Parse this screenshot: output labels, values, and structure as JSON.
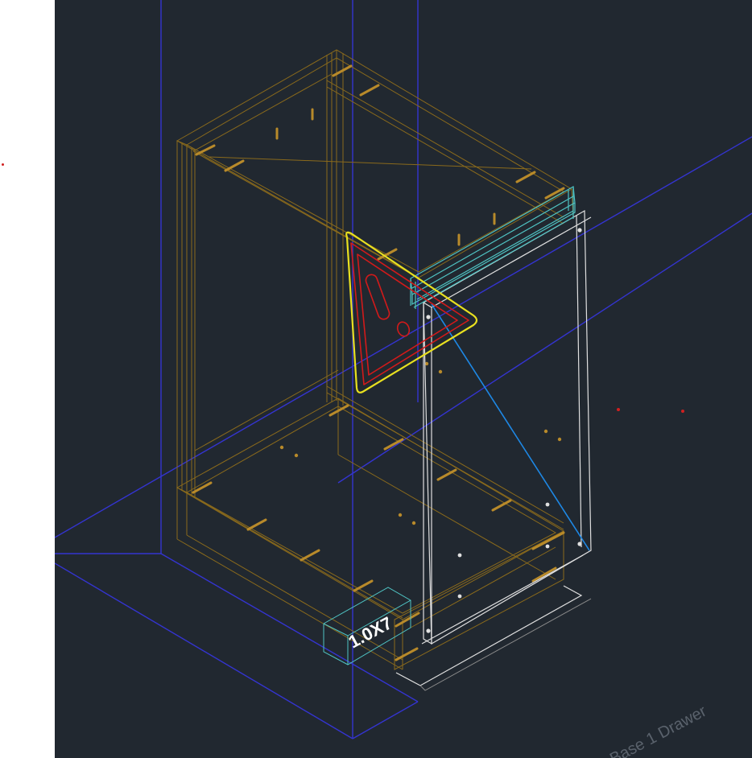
{
  "viewport": {
    "background": "#212830"
  },
  "annotations": {
    "dimension_label": "1.0X7",
    "layout_tab_label": "Base 1 Drawer"
  },
  "colors": {
    "cabinet_lines": "#8a6a1c",
    "hardware": "#b88a2a",
    "grid_axes": "#3434d0",
    "drawer_front": "#e0e0e0",
    "rail": "#4fc3c3",
    "warning_outer": "#e8e020",
    "warning_inner": "#d21a1a",
    "diagonal": "#1e88e5",
    "points": "#d02020"
  },
  "icons": {
    "warning": "warning-triangle-icon"
  }
}
